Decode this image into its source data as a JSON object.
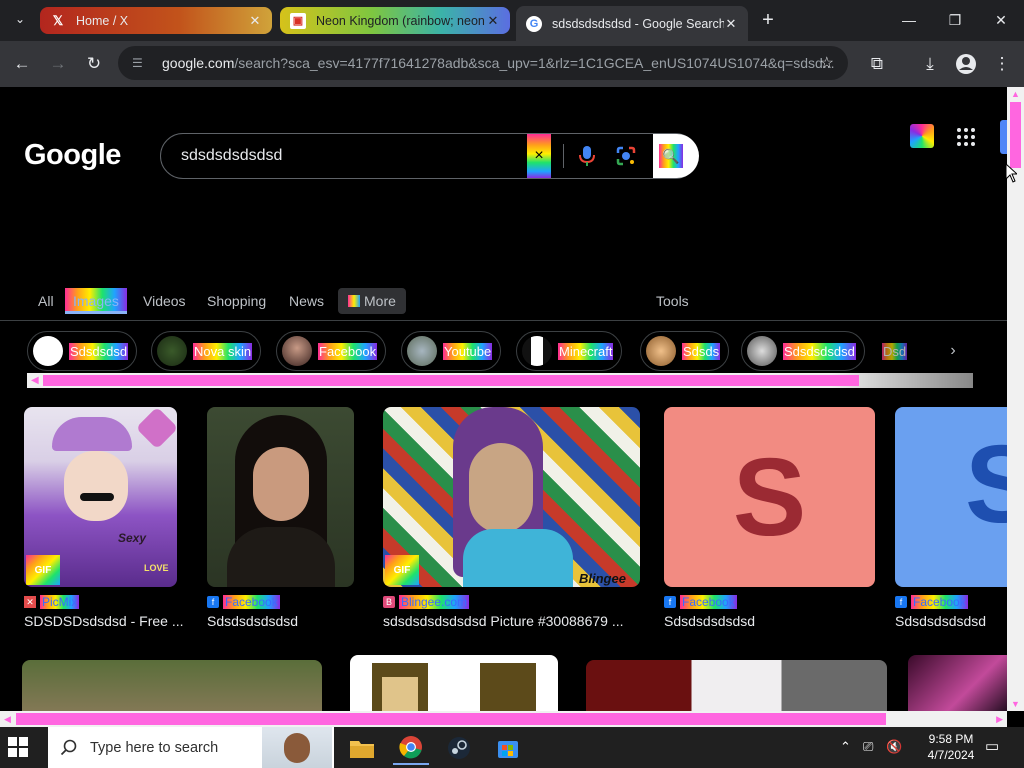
{
  "browser": {
    "tabs": [
      {
        "title": "Home / X",
        "favicon": "x-logo-icon"
      },
      {
        "title": "Neon Kingdom (rainbow; neon",
        "favicon": "neon-kingdom-icon"
      },
      {
        "title": "sdsdsdsdsdsd - Google Search",
        "favicon": "google-g-icon"
      }
    ],
    "active_tab": 2,
    "url_host": "google.com",
    "url_rest": "/search?sca_esv=4177f71641278adb&sca_upv=1&rlz=1C1GCEA_enUS1074US1074&q=sdsd..."
  },
  "search": {
    "logo": "Google",
    "query": "sdsdsdsdsdsd",
    "clear_icon": "×",
    "search_icon": "🔍"
  },
  "nav": {
    "tabs": [
      "All",
      "Images",
      "Videos",
      "Shopping",
      "News",
      "More"
    ],
    "active": "Images",
    "tools": "Tools"
  },
  "chips": [
    {
      "label": "Sdsdsdsd"
    },
    {
      "label": "Nova skin"
    },
    {
      "label": "Facebook"
    },
    {
      "label": "Youtube"
    },
    {
      "label": "Minecraft"
    },
    {
      "label": "Sdsds"
    },
    {
      "label": "Sdsdsdsdsd"
    },
    {
      "label": "Dsd"
    }
  ],
  "results": [
    {
      "source": "PicMix",
      "caption": "SDSDSDsdsdsd - Free ...",
      "gif": "GIF",
      "overlay": "Sexy",
      "overlay2": "LOVE"
    },
    {
      "source": "Facebook",
      "caption": "Sdsdsdsdsdsd"
    },
    {
      "source": "Blingee.com",
      "caption": "sdsdsdsdsdsdsd Picture #30088679 ...",
      "gif": "GIF",
      "overlay": "Blingee"
    },
    {
      "source": "Facebook",
      "caption": "Sdsdsdsdsdsd",
      "letter": "S"
    },
    {
      "source": "Facebook",
      "caption": "Sdsdsdsdsdsd",
      "letter": "S"
    }
  ],
  "taskbar": {
    "search_placeholder": "Type here to search",
    "time": "9:58 PM",
    "date": "4/7/2024"
  },
  "colors": {
    "accent_pink": "#ff66e0",
    "link_blue": "#8ab4f8",
    "tile_salmon": "#f28b82",
    "tile_blue": "#6aa0f0"
  }
}
